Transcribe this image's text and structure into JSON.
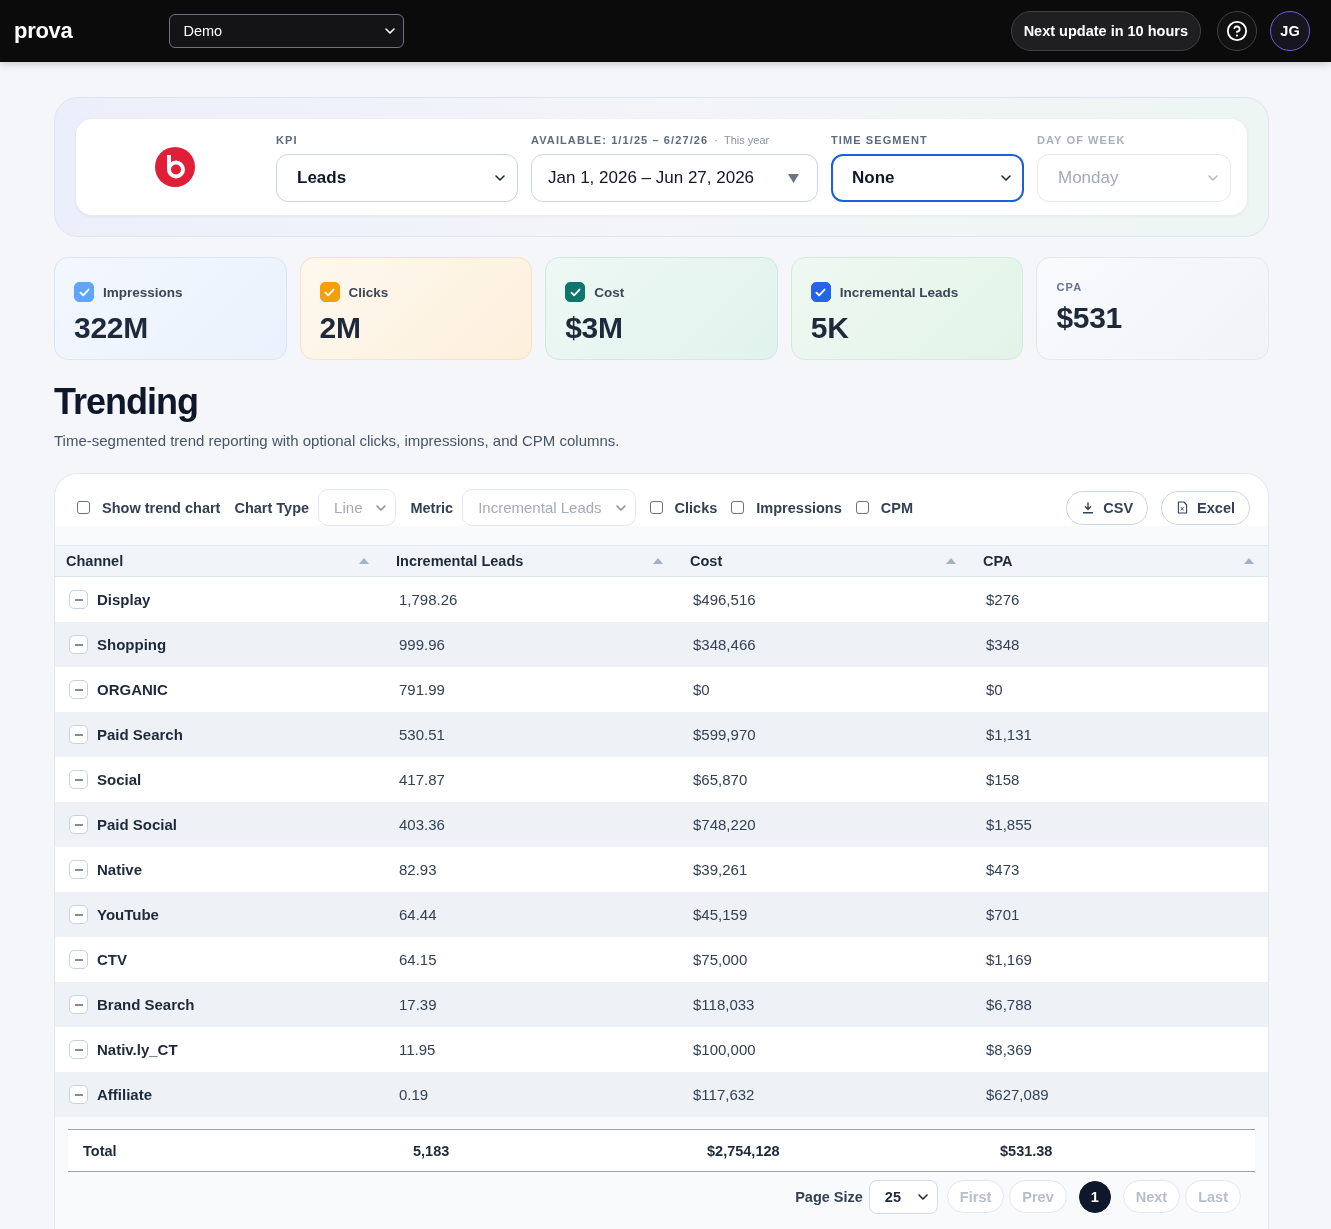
{
  "top_bar": {
    "logo": "prova",
    "workspace": "Demo",
    "update_badge": "Next update in 10 hours",
    "avatar": "JG"
  },
  "filters": [
    {
      "kind": "select",
      "label": "KPI",
      "value": "Leads",
      "focused": false,
      "disabled": false
    },
    {
      "kind": "date_range",
      "label": "AVAILABLE: 1/1/25 – 6/27/26",
      "separator": "·",
      "note": "This year",
      "value": "Jan 1, 2026 – Jun 27, 2026",
      "focused": false,
      "disabled": false
    },
    {
      "kind": "select",
      "label": "TIME SEGMENT",
      "value": "None",
      "focused": true,
      "disabled": false
    },
    {
      "kind": "select",
      "label": "DAY OF WEEK",
      "value": "Monday",
      "focused": false,
      "disabled": true
    }
  ],
  "metrics": [
    {
      "kind": "toggle",
      "label": "Impressions",
      "value": "322M",
      "checked": true,
      "color": "#60a5fa"
    },
    {
      "kind": "toggle",
      "label": "Clicks",
      "value": "2M",
      "checked": true,
      "color": "#f59e0b"
    },
    {
      "kind": "toggle",
      "label": "Cost",
      "value": "$3M",
      "checked": true,
      "color": "#0f766e"
    },
    {
      "kind": "toggle",
      "label": "Incremental Leads",
      "value": "5K",
      "checked": true,
      "color": "#2563eb"
    },
    {
      "kind": "plain",
      "label": "CPA",
      "value": "$531"
    }
  ],
  "section": {
    "title": "Trending",
    "subtitle": "Time-segmented trend reporting with optional clicks, impressions, and CPM columns."
  },
  "toolbar": {
    "controls": [
      {
        "kind": "checkbox",
        "label": "Show trend chart",
        "checked": false
      },
      {
        "kind": "select",
        "label": "Chart Type",
        "value": "Line",
        "disabled": true
      },
      {
        "kind": "select",
        "label": "Metric",
        "value": "Incremental Leads",
        "disabled": true
      },
      {
        "kind": "checkbox",
        "label": "Clicks",
        "checked": false
      },
      {
        "kind": "checkbox",
        "label": "Impressions",
        "checked": false
      },
      {
        "kind": "checkbox",
        "label": "CPM",
        "checked": false
      }
    ],
    "exports": [
      {
        "kind": "download",
        "label": "CSV"
      },
      {
        "kind": "spreadsheet",
        "label": "Excel"
      }
    ]
  },
  "table": {
    "columns": [
      "Channel",
      "Incremental Leads",
      "Cost",
      "CPA"
    ],
    "rows": [
      {
        "cells": [
          "Display",
          "1,798.26",
          "$496,516",
          "$276"
        ],
        "expanded": true
      },
      {
        "cells": [
          "Shopping",
          "999.96",
          "$348,466",
          "$348"
        ],
        "expanded": true
      },
      {
        "cells": [
          "ORGANIC",
          "791.99",
          "$0",
          "$0"
        ],
        "expanded": true
      },
      {
        "cells": [
          "Paid Search",
          "530.51",
          "$599,970",
          "$1,131"
        ],
        "expanded": true
      },
      {
        "cells": [
          "Social",
          "417.87",
          "$65,870",
          "$158"
        ],
        "expanded": true
      },
      {
        "cells": [
          "Paid Social",
          "403.36",
          "$748,220",
          "$1,855"
        ],
        "expanded": true
      },
      {
        "cells": [
          "Native",
          "82.93",
          "$39,261",
          "$473"
        ],
        "expanded": true
      },
      {
        "cells": [
          "YouTube",
          "64.44",
          "$45,159",
          "$701"
        ],
        "expanded": true
      },
      {
        "cells": [
          "CTV",
          "64.15",
          "$75,000",
          "$1,169"
        ],
        "expanded": true
      },
      {
        "cells": [
          "Brand Search",
          "17.39",
          "$118,033",
          "$6,788"
        ],
        "expanded": true
      },
      {
        "cells": [
          "Nativ.ly_CT",
          "11.95",
          "$100,000",
          "$8,369"
        ],
        "expanded": true
      },
      {
        "cells": [
          "Affiliate",
          "0.19",
          "$117,632",
          "$627,089"
        ],
        "expanded": true
      }
    ],
    "total": {
      "label": "Total",
      "cells": [
        "5,183",
        "$2,754,128",
        "$531.38"
      ]
    }
  },
  "pagination": {
    "page_size_label": "Page Size",
    "page_size": "25",
    "buttons": [
      {
        "kind": "nav",
        "label": "First",
        "disabled": true,
        "selected": false
      },
      {
        "kind": "nav",
        "label": "Prev",
        "disabled": true,
        "selected": false
      },
      {
        "kind": "page",
        "label": "1",
        "disabled": false,
        "selected": true
      },
      {
        "kind": "nav",
        "label": "Next",
        "disabled": true,
        "selected": false
      },
      {
        "kind": "nav",
        "label": "Last",
        "disabled": true,
        "selected": false
      }
    ]
  }
}
